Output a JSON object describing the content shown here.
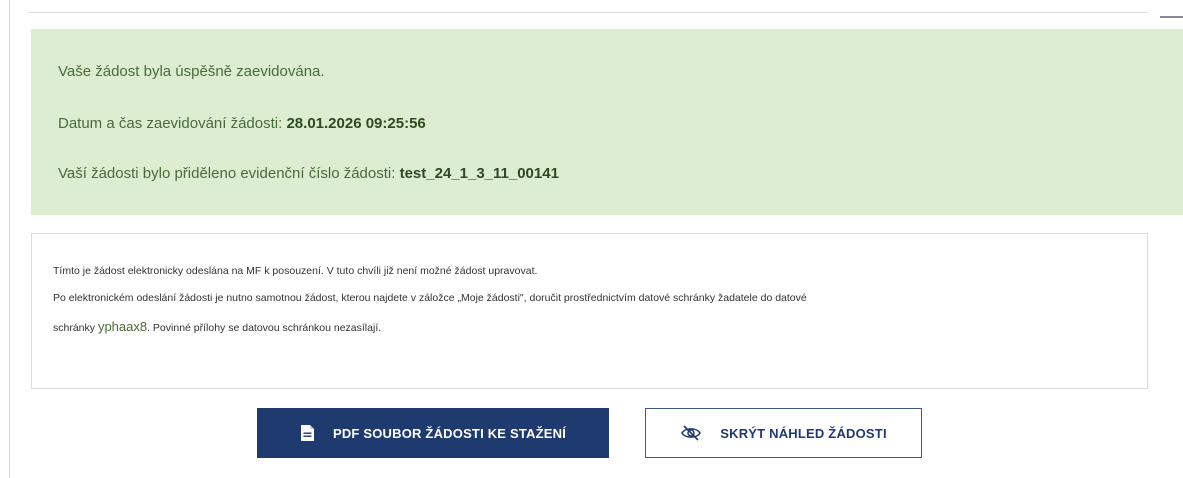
{
  "success_panel": {
    "line1": "Vaše žádost byla úspěšně zaevidována.",
    "line2_label": "Datum a čas zaevidování žádosti:",
    "line2_value": "28.01.2026 09:25:56",
    "line3_label": "Vaší žádosti bylo přiděleno evidenční číslo žádosti:",
    "line3_value": "test_24_1_3_11_00141"
  },
  "info_panel": {
    "line1": "Tímto je žádost elektronicky odeslána na MF k posouzení. V tuto chvíli již není možné žádost upravovat.",
    "line2": "Po elektronickém odeslání žádosti je nutno samotnou žádost, kterou najdete v záložce „Moje žádosti\", doručit  prostřednictvím datové schránky žadatele do datové",
    "line3_prefix": "schránky",
    "line3_box_id": "yphaax8",
    "line3_suffix": ". Povinné přílohy se datovou schránkou nezasílají."
  },
  "buttons": {
    "pdf_label": "PDF SOUBOR ŽÁDOSTI KE STAŽENÍ",
    "hide_label": "SKRÝT NÁHLED ŽÁDOSTI"
  },
  "icons": {
    "pdf": "file-document-icon",
    "hide": "eye-slash-icon"
  },
  "colors": {
    "success_bg": "#dcedd2",
    "primary": "#1f3a6f",
    "success_text": "#4a6b3a"
  }
}
